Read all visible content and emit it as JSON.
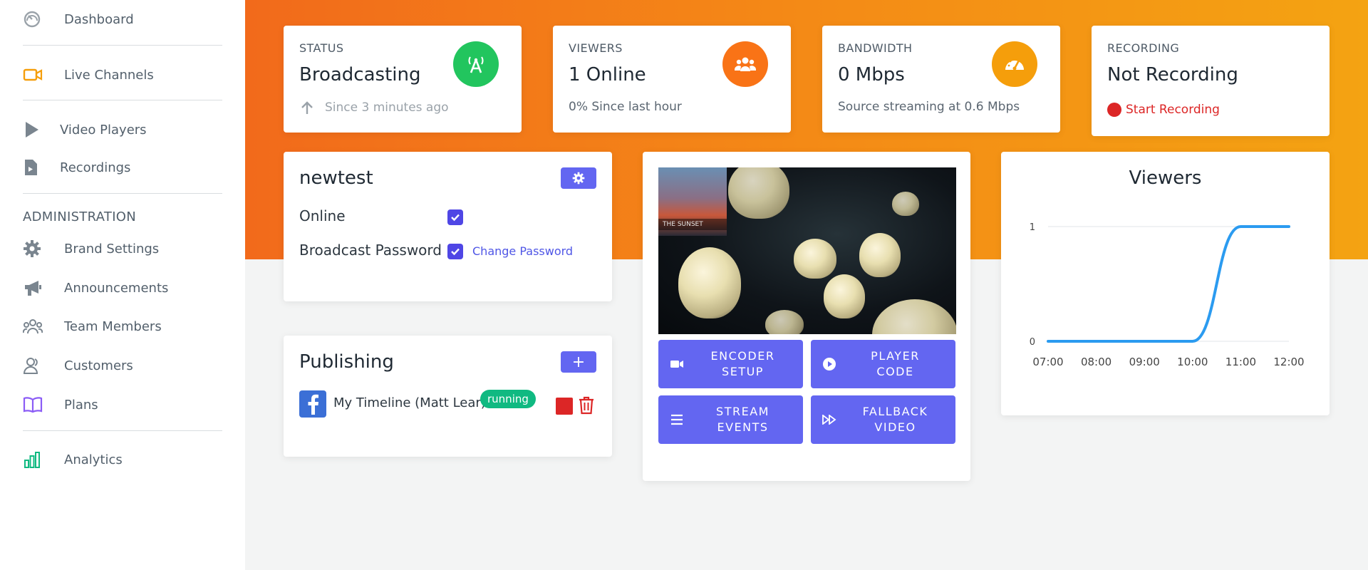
{
  "sidebar": {
    "items": [
      {
        "label": "Dashboard",
        "icon": "dashboard-icon"
      },
      {
        "label": "Live Channels",
        "icon": "video-camera-icon"
      },
      {
        "label": "Video Players",
        "icon": "play-icon"
      },
      {
        "label": "Recordings",
        "icon": "file-icon"
      },
      {
        "label": "Brand Settings",
        "icon": "gear-icon"
      },
      {
        "label": "Announcements",
        "icon": "megaphone-icon"
      },
      {
        "label": "Team Members",
        "icon": "team-icon"
      },
      {
        "label": "Customers",
        "icon": "users-icon"
      },
      {
        "label": "Plans",
        "icon": "book-icon"
      },
      {
        "label": "Analytics",
        "icon": "bar-chart-icon"
      }
    ],
    "admin_heading": "ADMINISTRATION"
  },
  "stats": {
    "status": {
      "label": "STATUS",
      "value": "Broadcasting",
      "sub": "Since 3 minutes ago",
      "color": "#22c55e"
    },
    "viewers": {
      "label": "VIEWERS",
      "value": "1 Online",
      "sub": "0% Since last hour",
      "color": "#f97316"
    },
    "bandwidth": {
      "label": "BANDWIDTH",
      "value": "0 Mbps",
      "sub": "Source streaming at 0.6 Mbps",
      "color": "#f59e0b"
    },
    "recording": {
      "label": "RECORDING",
      "value": "Not Recording",
      "action": "Start Recording",
      "color": "#dc2626"
    }
  },
  "channel": {
    "name": "newtest",
    "online_label": "Online",
    "online_checked": true,
    "password_label": "Broadcast Password",
    "password_checked": true,
    "change_password": "Change Password"
  },
  "publishing": {
    "title": "Publishing",
    "items": [
      {
        "name": "My Timeline (Matt Lear)",
        "status": "running",
        "platform": "facebook-icon"
      }
    ]
  },
  "video": {
    "pip_label": "THE SUNSET",
    "buttons": [
      {
        "label": "ENCODER\nSETUP",
        "icon": "camera-icon"
      },
      {
        "label": "PLAYER\nCODE",
        "icon": "play-circle-icon"
      },
      {
        "label": "STREAM\nEVENTS",
        "icon": "list-icon"
      },
      {
        "label": "FALLBACK\nVIDEO",
        "icon": "fast-forward-icon"
      }
    ]
  },
  "chart_data": {
    "type": "line",
    "title": "Viewers",
    "x": [
      "07:00",
      "08:00",
      "09:00",
      "10:00",
      "11:00",
      "12:00"
    ],
    "series": [
      {
        "values": [
          0,
          0,
          0,
          0,
          1,
          1
        ]
      }
    ],
    "ylim": [
      0,
      1
    ],
    "yticks": [
      "0",
      "1"
    ],
    "color": "#2b9bf0"
  },
  "colors": {
    "accent": "#6366f1",
    "banner_start": "#f26a1b",
    "banner_end": "#f4a312"
  }
}
